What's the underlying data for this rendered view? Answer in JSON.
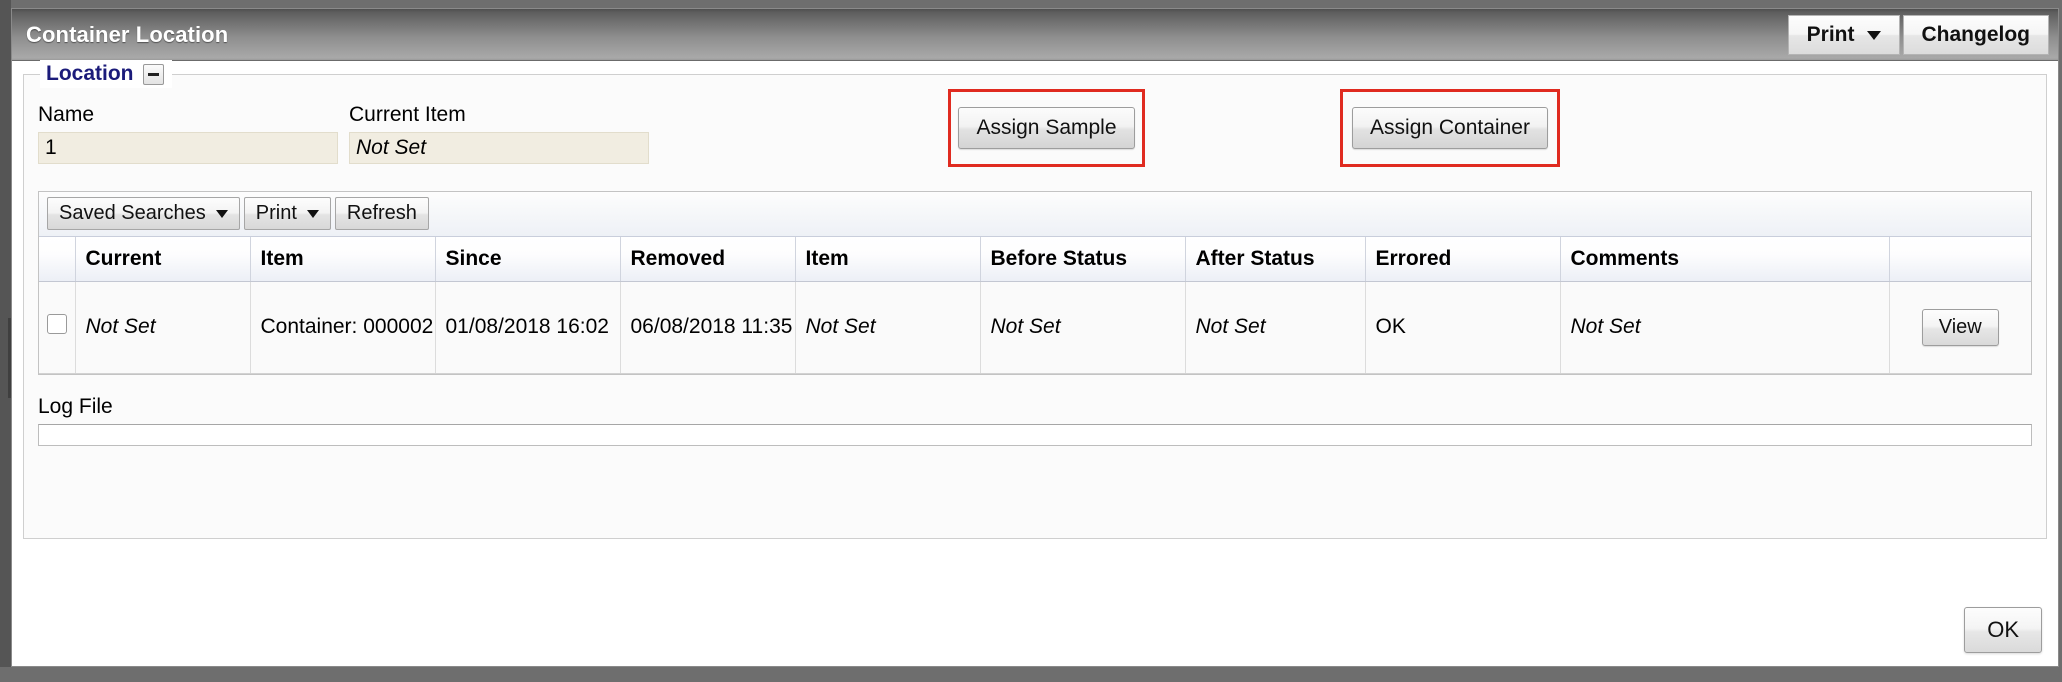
{
  "window": {
    "title": "Container Location",
    "actions": [
      {
        "label": "Print",
        "icon": "chevron-down-icon",
        "has_caret": true
      },
      {
        "label": "Changelog",
        "has_caret": false
      }
    ]
  },
  "location_group": {
    "legend": "Location",
    "collapse_icon": "minus-icon",
    "fields": [
      {
        "label": "Name",
        "value": "1",
        "italic": false
      },
      {
        "label": "Current Item",
        "value": "Not Set",
        "italic": true
      }
    ],
    "assign_buttons": [
      {
        "label": "Assign Sample",
        "highlighted": true
      },
      {
        "label": "Assign Container",
        "highlighted": true
      }
    ],
    "highlight_color": "#e02b20"
  },
  "grid": {
    "toolbar": [
      {
        "label": "Saved Searches",
        "has_caret": true
      },
      {
        "label": "Print",
        "has_caret": true
      },
      {
        "label": "Refresh",
        "has_caret": false
      }
    ],
    "columns": [
      "",
      "Current",
      "Item",
      "Since",
      "Removed",
      "Item",
      "Before Status",
      "After Status",
      "Errored",
      "Comments",
      ""
    ],
    "rows": [
      {
        "checked": false,
        "current": "Not Set",
        "item": "Container: 000002",
        "since": "01/08/2018 16:02",
        "removed": "06/08/2018 11:35",
        "item2": "Not Set",
        "before_status": "Not Set",
        "after_status": "Not Set",
        "errored": "OK",
        "comments": "Not Set",
        "action_label": "View"
      }
    ]
  },
  "logfile": {
    "label": "Log File",
    "value": "",
    "placeholder": ""
  },
  "footer": {
    "ok_label": "OK"
  }
}
